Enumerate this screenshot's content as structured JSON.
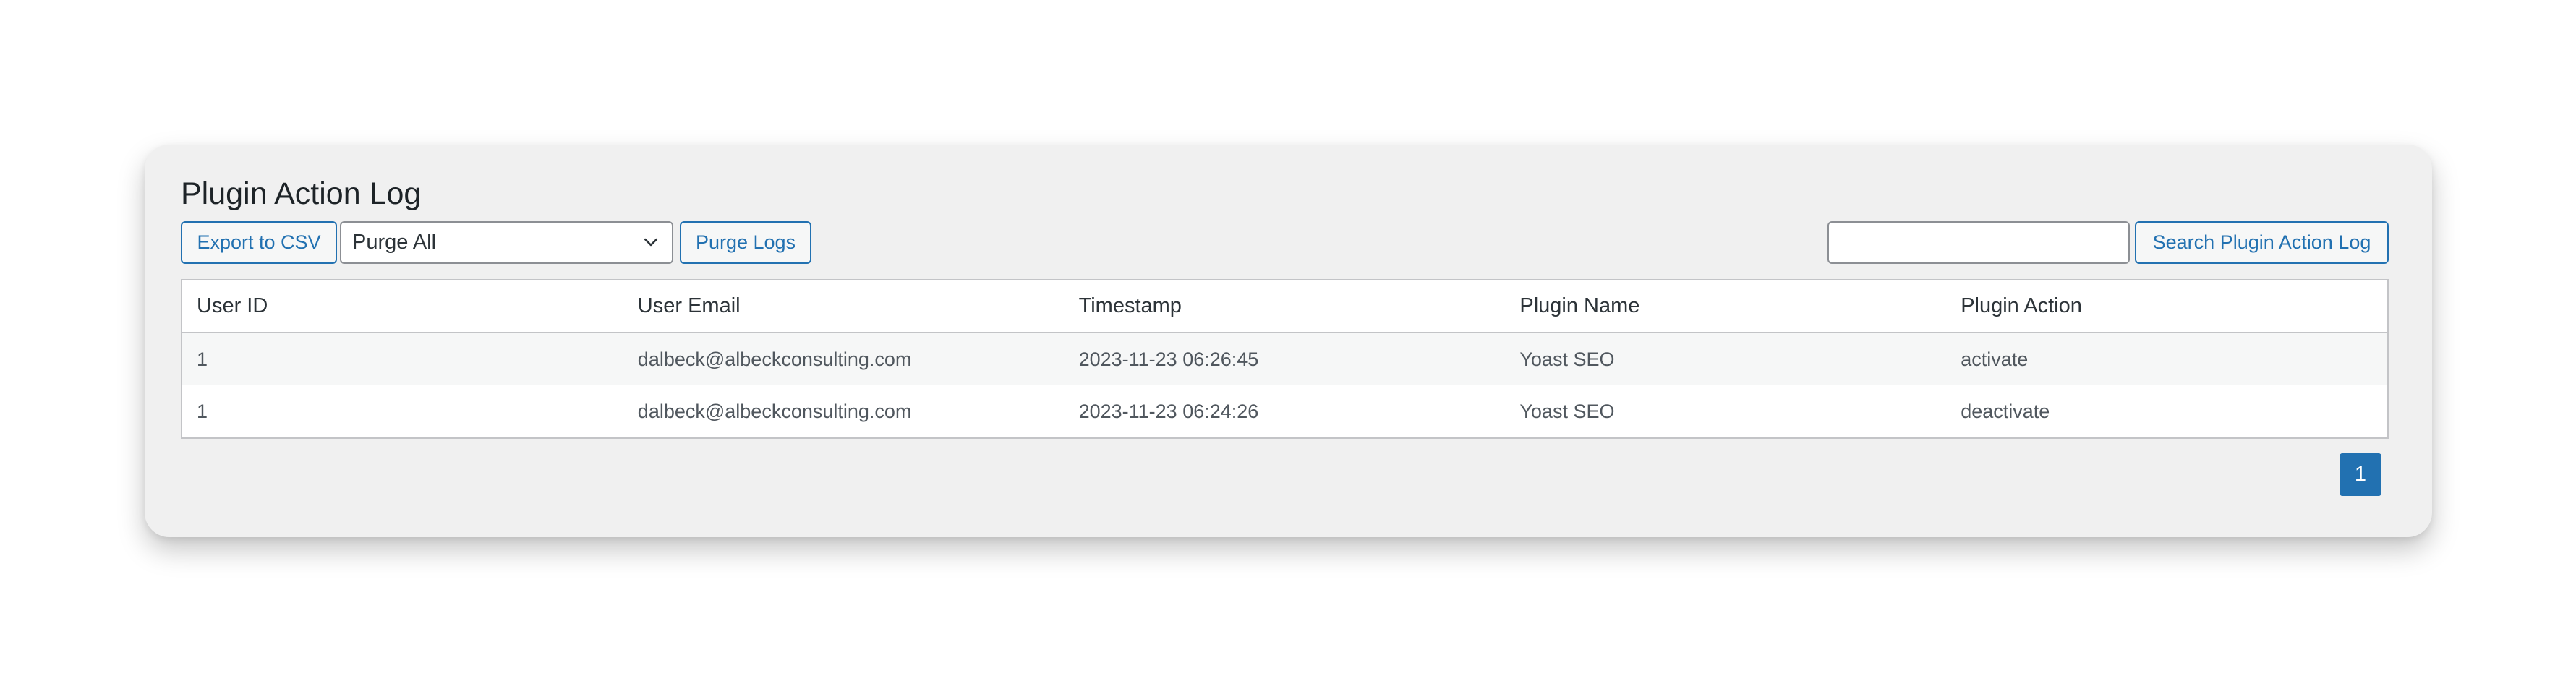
{
  "page": {
    "title": "Plugin Action Log"
  },
  "toolbar": {
    "export_label": "Export to CSV",
    "purge_select_value": "Purge All",
    "purge_label": "Purge Logs",
    "search_value": "",
    "search_button_label": "Search Plugin Action Log"
  },
  "table": {
    "columns": [
      "User ID",
      "User Email",
      "Timestamp",
      "Plugin Name",
      "Plugin Action"
    ],
    "rows": [
      [
        "1",
        "dalbeck@albeckconsulting.com",
        "2023-11-23 06:26:45",
        "Yoast SEO",
        "activate"
      ],
      [
        "1",
        "dalbeck@albeckconsulting.com",
        "2023-11-23 06:24:26",
        "Yoast SEO",
        "deactivate"
      ]
    ]
  },
  "pagination": {
    "current_page": "1"
  },
  "icons": {
    "select_arrow": "chevron-down-icon"
  },
  "colors": {
    "accent": "#2271b1",
    "panel_background": "#f0f0f0",
    "border": "#c3c4c7"
  }
}
